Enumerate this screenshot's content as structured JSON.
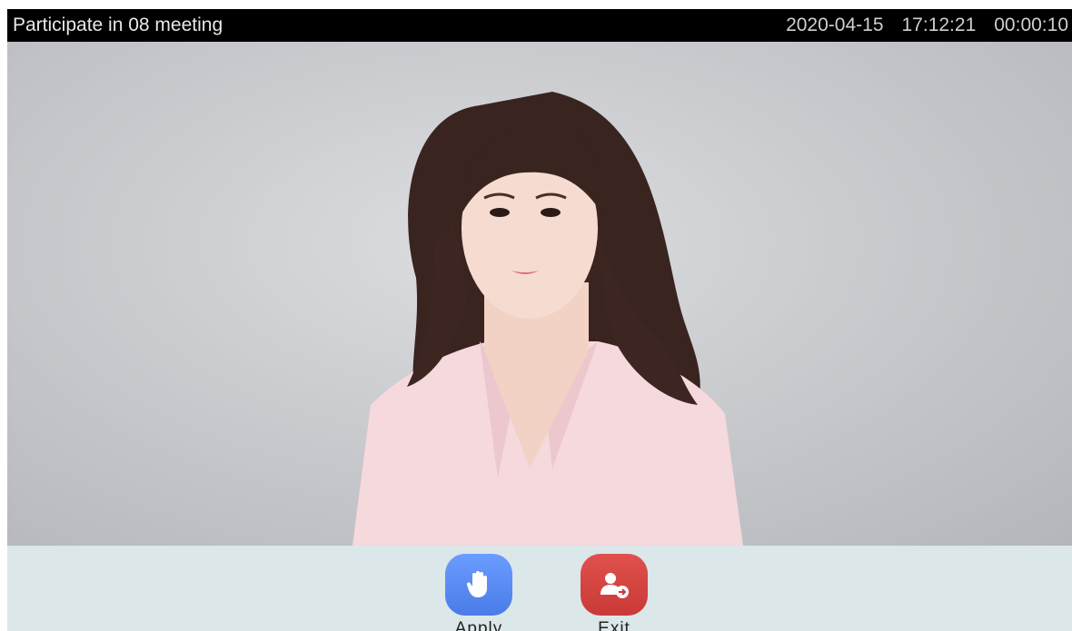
{
  "header": {
    "title": "Participate in 08 meeting",
    "date": "2020-04-15",
    "time": "17:12:21",
    "duration": "00:00:10"
  },
  "video": {
    "icon": "participant-video-icon"
  },
  "controls": {
    "apply": {
      "label": "Apply",
      "icon": "raise-hand-icon",
      "color": "#5b8df5"
    },
    "exit": {
      "label": "Exit",
      "icon": "exit-user-icon",
      "color": "#d9423f"
    }
  },
  "colors": {
    "top_bar": "#000000",
    "control_bar": "#dbe7e9",
    "video_background": "#c9cbcf"
  }
}
